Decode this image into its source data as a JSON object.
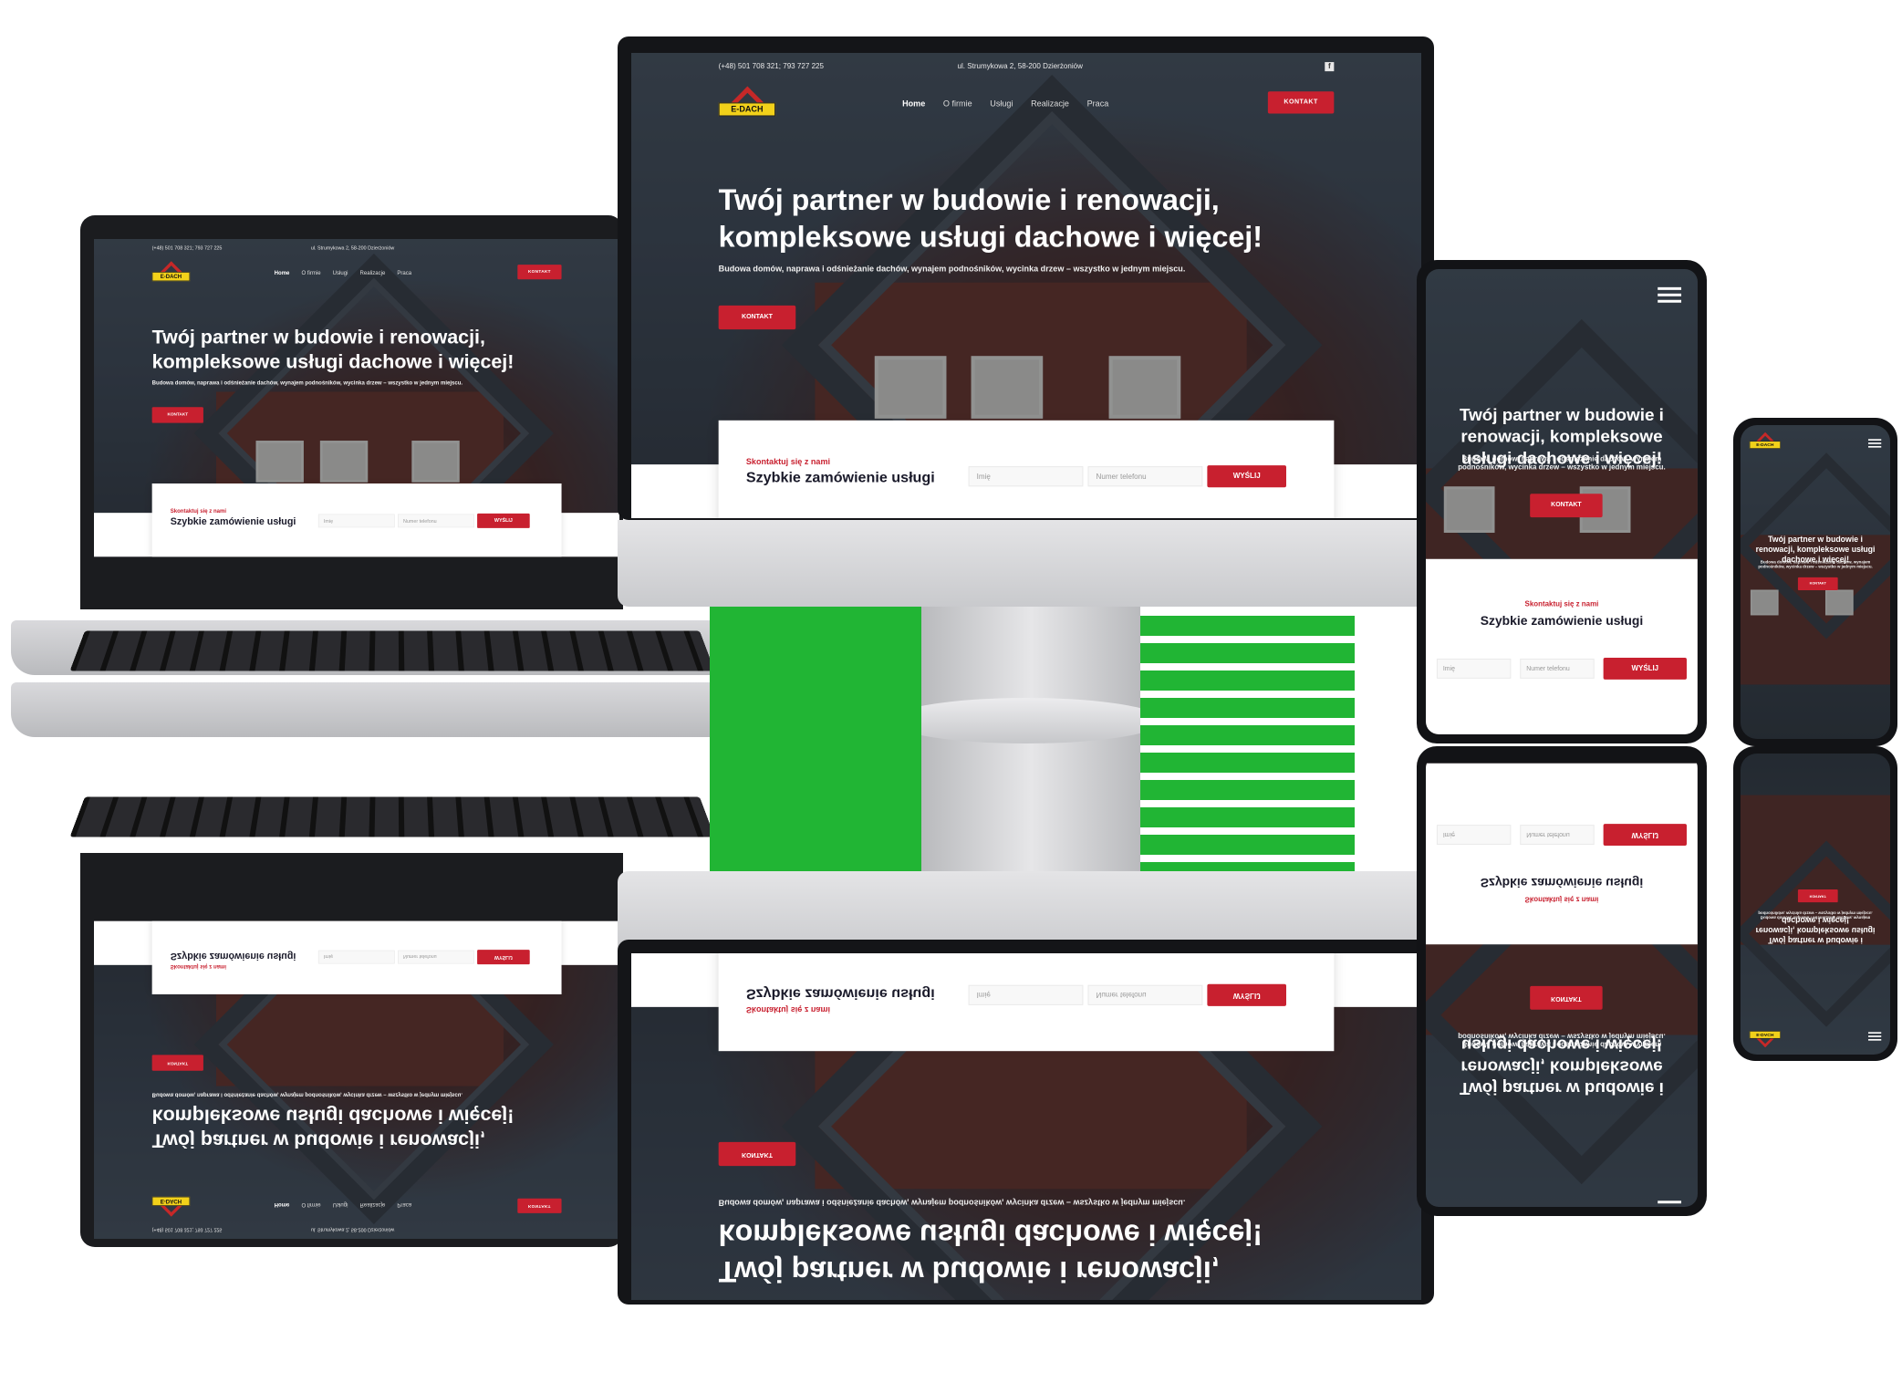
{
  "site": {
    "phone": "(+48) 501 708 321; 793 727 225",
    "address": "ul. Strumykowa 2, 58-200 Dzierżoniów",
    "logo_text": "E-DACH",
    "nav": [
      "Home",
      "O firmie",
      "Usługi",
      "Realizacje",
      "Praca"
    ],
    "contact_button": "KONTAKT",
    "hero_title": "Twój partner w budowie i renowacji, kompleksowe usługi dachowe i więcej!",
    "hero_subtitle": "Budowa domów, naprawa i odśnieżanie dachów, wynajem podnośników, wycinka drzew – wszystko w jednym miejscu.",
    "hero_button": "KONTAKT",
    "form_kicker": "Skontaktuj się z nami",
    "form_title": "Szybkie zamówienie usługi",
    "name_placeholder": "Imię",
    "phone_placeholder": "Numer telefonu",
    "send_button": "WYŚLIJ"
  },
  "colors": {
    "accent": "#c8202f",
    "logo_yellow": "#f2d11a",
    "dark_text": "#1a1a2a",
    "green": "#21b534"
  },
  "icons": {
    "facebook": "facebook-icon",
    "phone": "phone-icon",
    "menu": "hamburger-icon",
    "chevron": "chevron-down-icon"
  }
}
